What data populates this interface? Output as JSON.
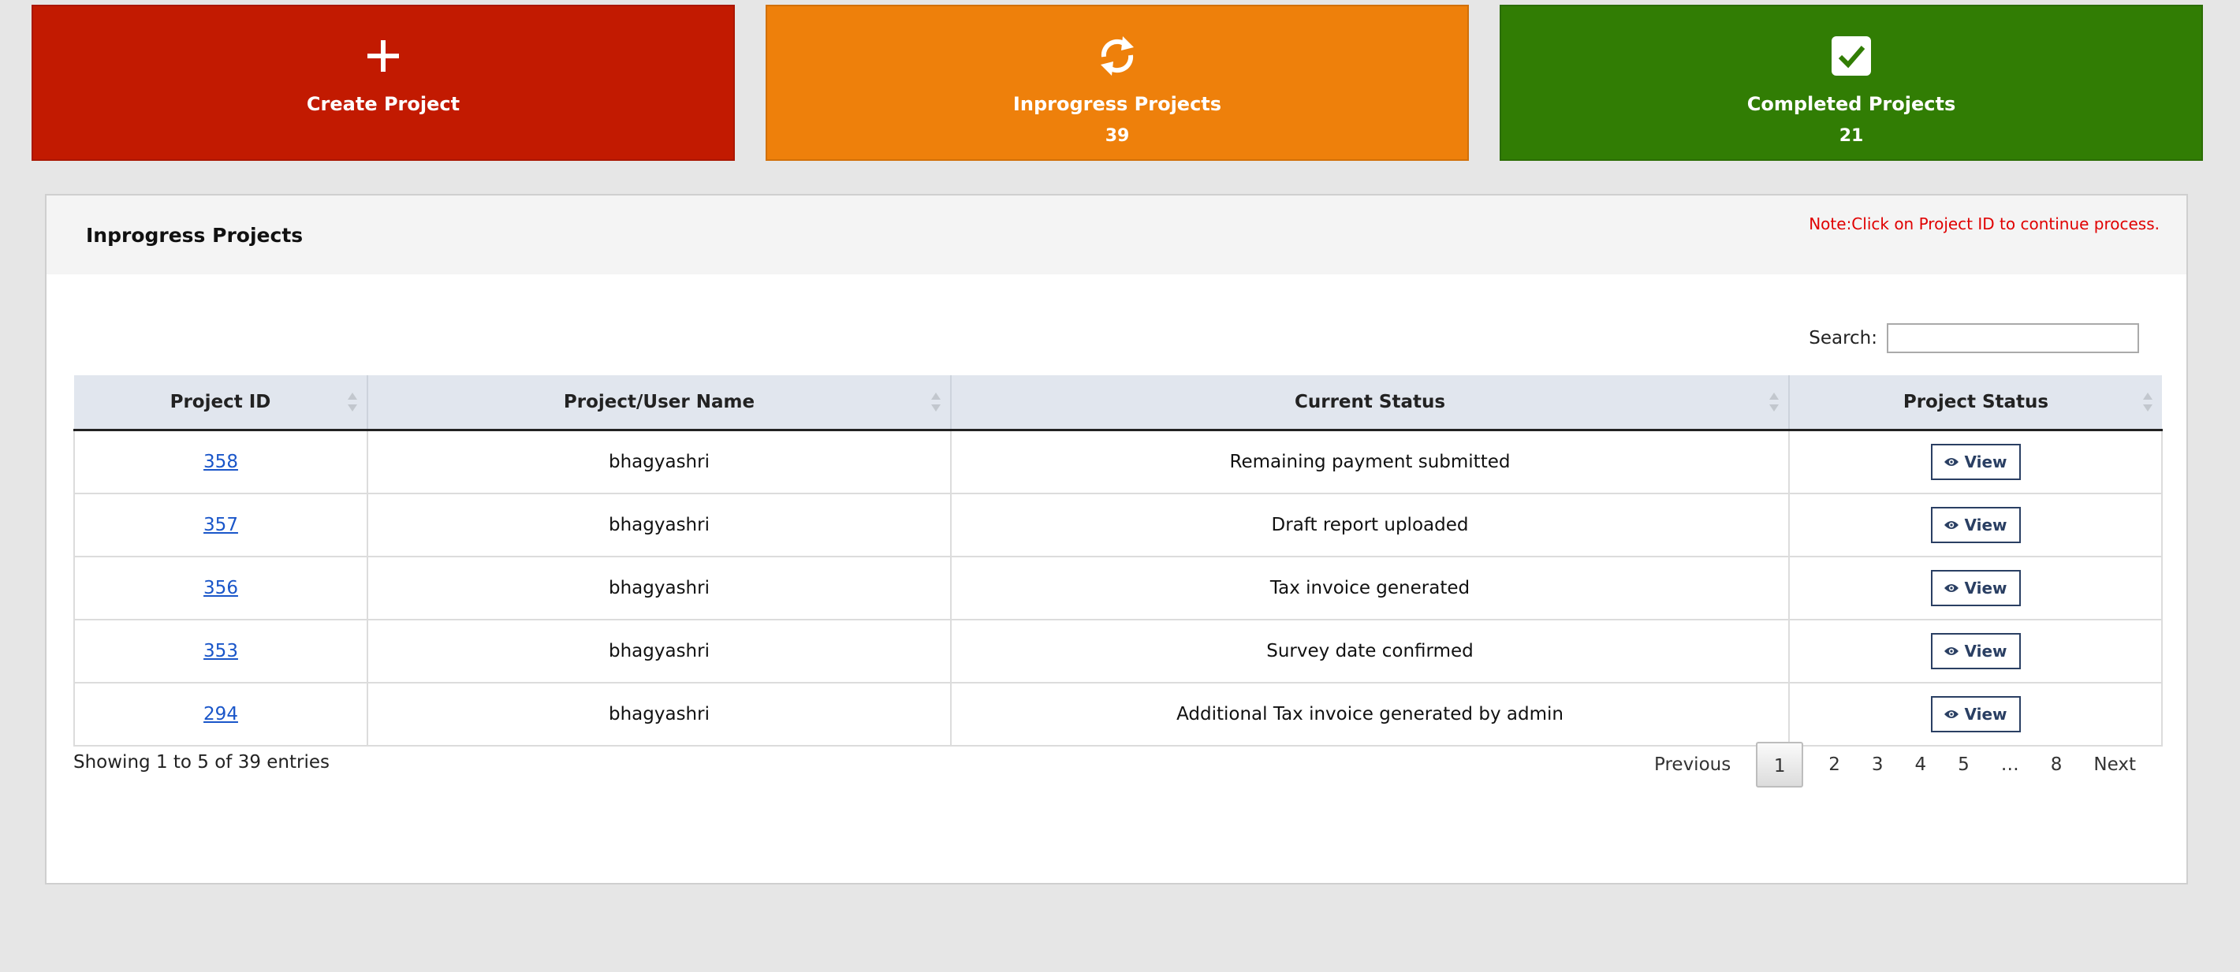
{
  "tiles": {
    "create": {
      "label": "Create Project",
      "color": "#c21a01",
      "icon": "plus-icon"
    },
    "inprogress": {
      "label": "Inprogress Projects",
      "count": "39",
      "color": "#ee800b",
      "icon": "refresh-icon"
    },
    "completed": {
      "label": "Completed Projects",
      "count": "21",
      "color": "#317d04",
      "icon": "checkbox-checked-icon"
    }
  },
  "panel": {
    "title": "Inprogress Projects",
    "note": "Note:Click on Project ID to continue process.",
    "search_label": "Search:",
    "search_value": ""
  },
  "table": {
    "columns": [
      "Project ID",
      "Project/User Name",
      "Current Status",
      "Project Status"
    ],
    "rows": [
      {
        "id": "358",
        "name": "bhagyashri",
        "status": "Remaining payment submitted",
        "action": "View"
      },
      {
        "id": "357",
        "name": "bhagyashri",
        "status": "Draft report uploaded",
        "action": "View"
      },
      {
        "id": "356",
        "name": "bhagyashri",
        "status": "Tax invoice generated",
        "action": "View"
      },
      {
        "id": "353",
        "name": "bhagyashri",
        "status": "Survey date confirmed",
        "action": "View"
      },
      {
        "id": "294",
        "name": "bhagyashri",
        "status": "Additional Tax invoice generated by admin",
        "action": "View"
      }
    ]
  },
  "footer": {
    "info": "Showing 1 to 5 of 39 entries",
    "pagination": {
      "previous": "Previous",
      "pages": [
        "1",
        "2",
        "3",
        "4",
        "5"
      ],
      "ellipsis": "…",
      "last": "8",
      "next": "Next",
      "current": "1"
    }
  }
}
